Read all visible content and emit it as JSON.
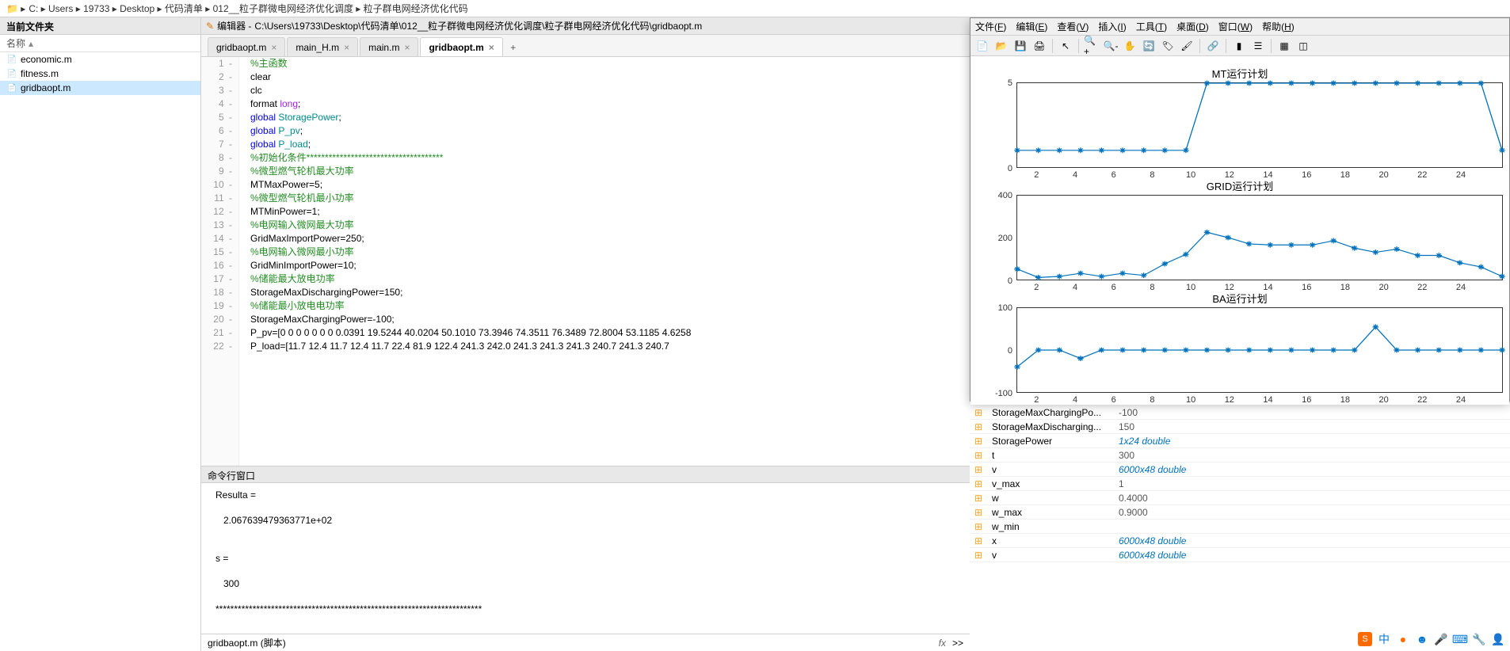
{
  "breadcrumb": [
    "C:",
    "Users",
    "19733",
    "Desktop",
    "代码清单",
    "012__粒子群微电网经济优化调度",
    "粒子群电网经济优化代码"
  ],
  "left_panel": {
    "title": "当前文件夹",
    "col": "名称",
    "files": [
      {
        "name": "economic.m",
        "selected": false
      },
      {
        "name": "fitness.m",
        "selected": false
      },
      {
        "name": "gridbaopt.m",
        "selected": true
      }
    ]
  },
  "editor": {
    "title_prefix": "编辑器 - ",
    "title_path": "C:\\Users\\19733\\Desktop\\代码清单\\012__粒子群微电网经济优化调度\\粒子群电网经济优化代码\\gridbaopt.m",
    "tabs": [
      {
        "label": "gridbaopt.m",
        "active": false
      },
      {
        "label": "main_H.m",
        "active": false
      },
      {
        "label": "main.m",
        "active": false
      },
      {
        "label": "gridbaopt.m",
        "active": true
      }
    ],
    "lines": [
      {
        "n": 1,
        "tokens": [
          {
            "t": "%主函数",
            "c": "c-comment"
          }
        ]
      },
      {
        "n": 2,
        "tokens": [
          {
            "t": "clear",
            "c": ""
          }
        ]
      },
      {
        "n": 3,
        "tokens": [
          {
            "t": "clc",
            "c": ""
          }
        ]
      },
      {
        "n": 4,
        "tokens": [
          {
            "t": "format ",
            "c": ""
          },
          {
            "t": "long",
            "c": "c-str"
          },
          {
            "t": ";",
            "c": ""
          }
        ]
      },
      {
        "n": 5,
        "tokens": [
          {
            "t": "global ",
            "c": "c-key"
          },
          {
            "t": "StoragePower",
            "c": "c-teal"
          },
          {
            "t": ";",
            "c": ""
          }
        ]
      },
      {
        "n": 6,
        "tokens": [
          {
            "t": "global ",
            "c": "c-key"
          },
          {
            "t": "P_pv",
            "c": "c-teal"
          },
          {
            "t": ";",
            "c": ""
          }
        ]
      },
      {
        "n": 7,
        "tokens": [
          {
            "t": "global ",
            "c": "c-key"
          },
          {
            "t": "P_load",
            "c": "c-teal"
          },
          {
            "t": ";",
            "c": ""
          }
        ]
      },
      {
        "n": 8,
        "tokens": [
          {
            "t": "%初始化条件*************************************",
            "c": "c-comment"
          }
        ]
      },
      {
        "n": 9,
        "tokens": [
          {
            "t": "%微型燃气轮机最大功率",
            "c": "c-comment"
          }
        ]
      },
      {
        "n": 10,
        "tokens": [
          {
            "t": "MTMaxPower=5;",
            "c": ""
          }
        ]
      },
      {
        "n": 11,
        "tokens": [
          {
            "t": "%微型燃气轮机最小功率",
            "c": "c-comment"
          }
        ]
      },
      {
        "n": 12,
        "tokens": [
          {
            "t": "MTMinPower=1;",
            "c": ""
          }
        ]
      },
      {
        "n": 13,
        "tokens": [
          {
            "t": "%电网输入微网最大功率",
            "c": "c-comment"
          }
        ]
      },
      {
        "n": 14,
        "tokens": [
          {
            "t": "GridMaxImportPower=250;",
            "c": ""
          }
        ]
      },
      {
        "n": 15,
        "tokens": [
          {
            "t": "%电网输入微网最小功率",
            "c": "c-comment"
          }
        ]
      },
      {
        "n": 16,
        "tokens": [
          {
            "t": "GridMinImportPower=10;",
            "c": ""
          }
        ]
      },
      {
        "n": 17,
        "tokens": [
          {
            "t": "%储能最大放电功率",
            "c": "c-comment"
          }
        ]
      },
      {
        "n": 18,
        "tokens": [
          {
            "t": "StorageMaxDischargingPower=150;",
            "c": ""
          }
        ]
      },
      {
        "n": 19,
        "tokens": [
          {
            "t": "%储能最小放电电功率",
            "c": "c-comment"
          }
        ]
      },
      {
        "n": 20,
        "tokens": [
          {
            "t": "StorageMaxChargingPower=-100;",
            "c": ""
          }
        ]
      },
      {
        "n": 21,
        "tokens": [
          {
            "t": "P_pv=[0 0 0 0 0 0 0 0.0391 19.5244 40.0204 50.1010 73.3946 74.3511 76.3489 72.8004 53.1185 4.6258",
            "c": ""
          }
        ]
      },
      {
        "n": 22,
        "tokens": [
          {
            "t": "P_load=[11.7 12.4 11.7 12.4 11.7 22.4 81.9 122.4 241.3 242.0 241.3 241.3 241.3 240.7 241.3 240.7",
            "c": ""
          }
        ]
      }
    ]
  },
  "cmd": {
    "title": "命令行窗口",
    "lines": [
      "Resulta =",
      "",
      "   2.067639479363771e+02",
      "",
      "",
      "s =",
      "",
      "   300",
      "",
      "************************************************************************"
    ],
    "prompt": ">>"
  },
  "status": {
    "file": "gridbaopt.m (脚本)"
  },
  "figure": {
    "menus": [
      {
        "pre": "文件(",
        "u": "F",
        "post": ")"
      },
      {
        "pre": "编辑(",
        "u": "E",
        "post": ")"
      },
      {
        "pre": "查看(",
        "u": "V",
        "post": ")"
      },
      {
        "pre": "插入(",
        "u": "I",
        "post": ")"
      },
      {
        "pre": "工具(",
        "u": "T",
        "post": ")"
      },
      {
        "pre": "桌面(",
        "u": "D",
        "post": ")"
      },
      {
        "pre": "窗口(",
        "u": "W",
        "post": ")"
      },
      {
        "pre": "帮助(",
        "u": "H",
        "post": ")"
      }
    ],
    "toolbar": [
      "new",
      "open",
      "save",
      "print",
      "sep",
      "arrow",
      "sep",
      "zoomin",
      "zoomout",
      "pan",
      "rotate",
      "datatip",
      "brush",
      "sep",
      "link",
      "sep",
      "colorbar",
      "legend",
      "sep",
      "grid",
      "dock"
    ]
  },
  "chart_data": [
    {
      "type": "line",
      "title": "MT运行计划",
      "x": [
        1,
        2,
        3,
        4,
        5,
        6,
        7,
        8,
        9,
        10,
        11,
        12,
        13,
        14,
        15,
        16,
        17,
        18,
        19,
        20,
        21,
        22,
        23,
        24
      ],
      "values": [
        1,
        1,
        1,
        1,
        1,
        1,
        1,
        1,
        1,
        5,
        5,
        5,
        5,
        5,
        5,
        5,
        5,
        5,
        5,
        5,
        5,
        5,
        5,
        1
      ],
      "ylim": [
        0,
        5
      ],
      "yticks": [
        0,
        5
      ],
      "xticks": [
        2,
        4,
        6,
        8,
        10,
        12,
        14,
        16,
        18,
        20,
        22,
        24
      ]
    },
    {
      "type": "line",
      "title": "GRID运行计划",
      "x": [
        1,
        2,
        3,
        4,
        5,
        6,
        7,
        8,
        9,
        10,
        11,
        12,
        13,
        14,
        15,
        16,
        17,
        18,
        19,
        20,
        21,
        22,
        23,
        24
      ],
      "values": [
        50,
        10,
        15,
        30,
        15,
        30,
        20,
        75,
        120,
        225,
        200,
        170,
        165,
        165,
        165,
        185,
        150,
        130,
        145,
        115,
        115,
        80,
        60,
        15
      ],
      "ylim": [
        0,
        400
      ],
      "yticks": [
        0,
        200,
        400
      ],
      "xticks": [
        2,
        4,
        6,
        8,
        10,
        12,
        14,
        16,
        18,
        20,
        22,
        24
      ]
    },
    {
      "type": "line",
      "title": "BA运行计划",
      "x": [
        1,
        2,
        3,
        4,
        5,
        6,
        7,
        8,
        9,
        10,
        11,
        12,
        13,
        14,
        15,
        16,
        17,
        18,
        19,
        20,
        21,
        22,
        23,
        24
      ],
      "values": [
        -40,
        0,
        0,
        -20,
        0,
        0,
        0,
        0,
        0,
        0,
        0,
        0,
        0,
        0,
        0,
        0,
        0,
        55,
        0,
        0,
        0,
        0,
        0,
        0
      ],
      "ylim": [
        -100,
        100
      ],
      "yticks": [
        -100,
        0,
        100
      ],
      "xticks": [
        2,
        4,
        6,
        8,
        10,
        12,
        14,
        16,
        18,
        20,
        22,
        24
      ]
    }
  ],
  "workspace": [
    {
      "name": "StorageMaxChargingPo...",
      "val": "-100",
      "arr": false
    },
    {
      "name": "StorageMaxDischarging...",
      "val": "150",
      "arr": false
    },
    {
      "name": "StoragePower",
      "val": "1x24 double",
      "arr": true
    },
    {
      "name": "t",
      "val": "300",
      "arr": false
    },
    {
      "name": "v",
      "val": "6000x48 double",
      "arr": true
    },
    {
      "name": "v_max",
      "val": "1",
      "arr": false
    },
    {
      "name": "w",
      "val": "0.4000",
      "arr": false
    },
    {
      "name": "w_max",
      "val": "0.9000",
      "arr": false
    },
    {
      "name": "w_min",
      "val": "",
      "arr": false
    },
    {
      "name": "x",
      "val": "6000x48 double",
      "arr": true
    },
    {
      "name": "v",
      "val": "6000x48 double",
      "arr": true
    }
  ],
  "tray": {
    "cn": "中",
    "dot": "●",
    "smile": "☻"
  }
}
